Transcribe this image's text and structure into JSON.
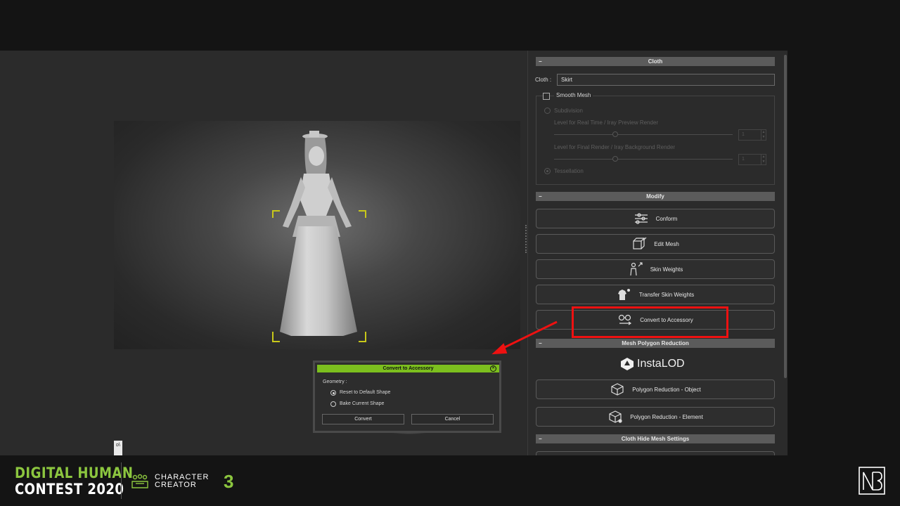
{
  "cloth_section": {
    "title": "Cloth",
    "cloth_label": "Cloth :",
    "cloth_value": "Skirt",
    "smooth_mesh_label": "Smooth Mesh",
    "subdivision_label": "Subdivision",
    "level_realtime_label": "Level for Real Time / Iray Preview Render",
    "level_realtime_value": "1",
    "level_final_label": "Level for Final Render / Iray Background Render",
    "level_final_value": "1",
    "tessellation_label": "Tessellation"
  },
  "modify_section": {
    "title": "Modify",
    "buttons": [
      {
        "label": "Conform",
        "icon": "conform-icon"
      },
      {
        "label": "Edit Mesh",
        "icon": "edit-mesh-icon"
      },
      {
        "label": "Skin Weights",
        "icon": "skin-weights-icon"
      },
      {
        "label": "Transfer Skin Weights",
        "icon": "transfer-skin-weights-icon"
      },
      {
        "label": "Convert to Accessory",
        "icon": "glasses-icon"
      }
    ]
  },
  "reduction_section": {
    "title": "Mesh Polygon Reduction",
    "brand": "InstaLOD",
    "buttons": [
      {
        "label": "Polygon Reduction - Object",
        "icon": "cube-icon"
      },
      {
        "label": "Polygon Reduction - Element",
        "icon": "cube-element-icon"
      }
    ]
  },
  "hide_mesh_section": {
    "title": "Cloth Hide Mesh Settings"
  },
  "dialog": {
    "title": "Convert to Accessory",
    "geometry_label": "Geometry :",
    "option_reset": "Reset to Default Shape",
    "option_bake": "Bake Current Shape",
    "selected": "Reset to Default Shape",
    "convert_label": "Convert",
    "cancel_label": "Cancel"
  },
  "corner_icon_text": "ᴅ\\",
  "footer": {
    "contest_line1": "DIGITAL HUMAN",
    "contest_line2": "CONTEST 2020",
    "cc_line1": "CHARACTER",
    "cc_line2": "CREATOR",
    "cc_version": "3"
  },
  "colors": {
    "accent_green": "#8cc63f",
    "dialog_title_green": "#7cbf1e",
    "highlight_red": "#ee1111",
    "panel_bg": "#2b2b2b"
  }
}
